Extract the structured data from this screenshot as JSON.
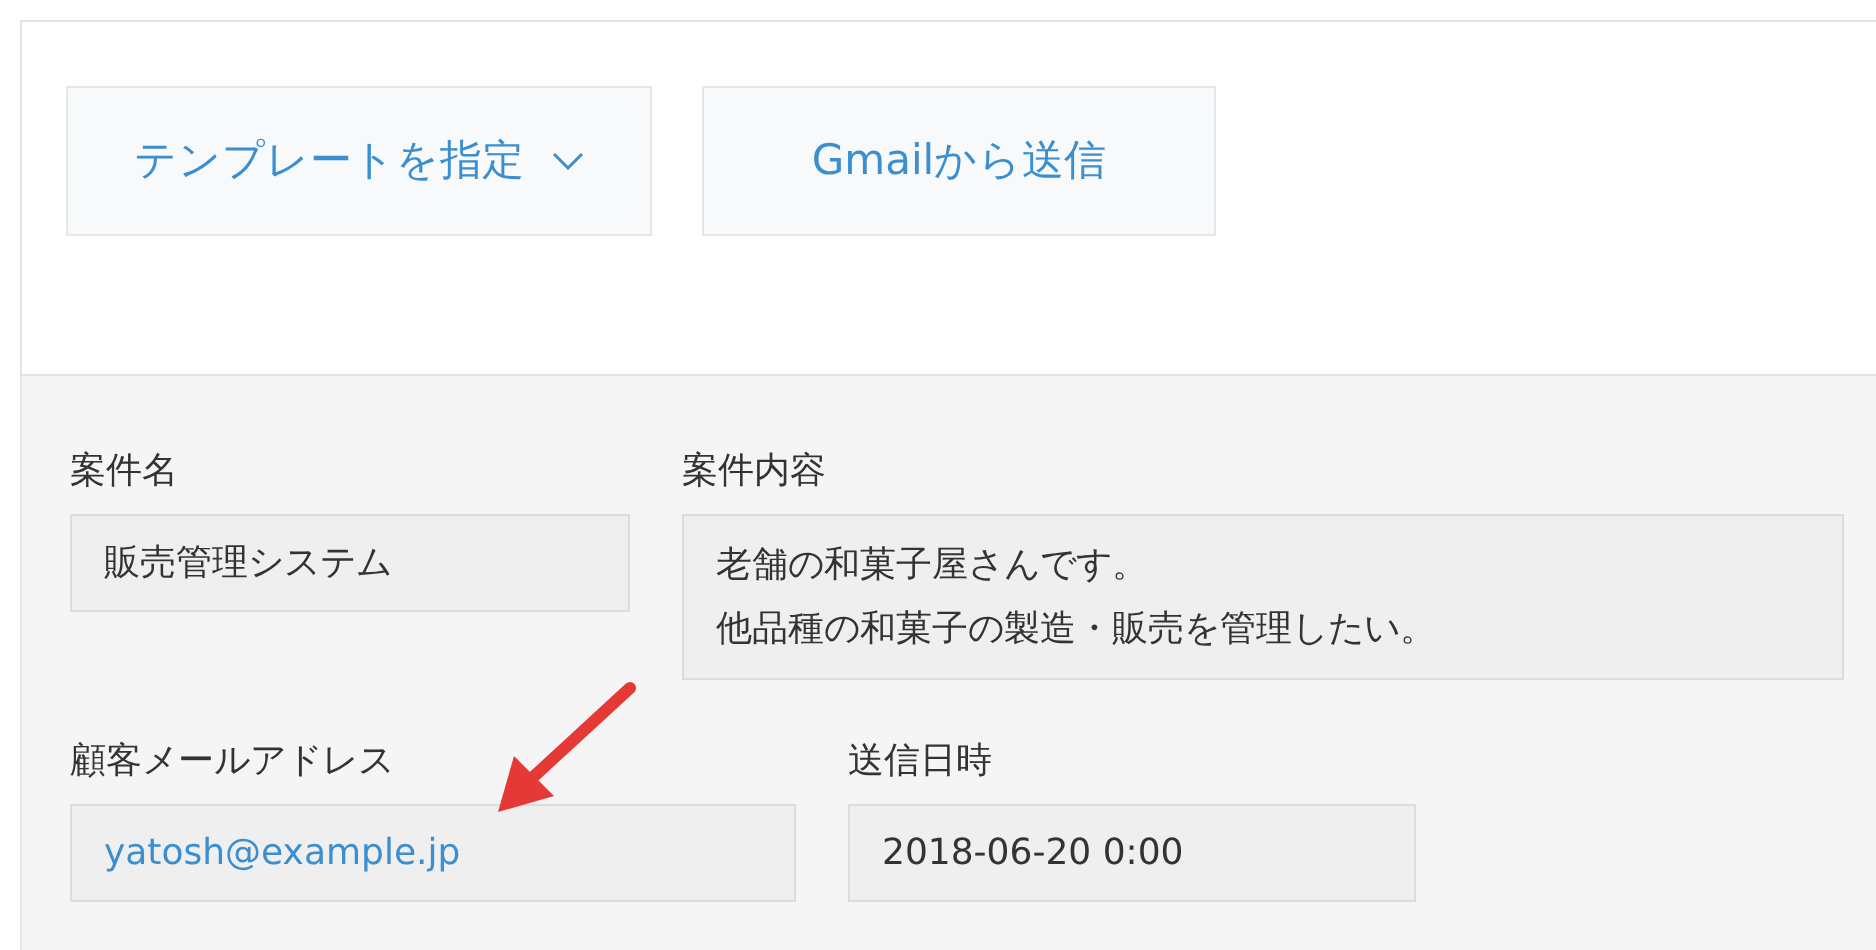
{
  "toolbar": {
    "buttons": [
      {
        "label": "テンプレートを指定",
        "kind": "dropdown"
      },
      {
        "label": "Gmailから送信",
        "kind": "plain"
      }
    ]
  },
  "form": {
    "rows": [
      [
        {
          "label": "案件名",
          "kind": "text",
          "lines": [
            "販売管理システム"
          ]
        },
        {
          "label": "案件内容",
          "kind": "multiline",
          "lines": [
            "老舗の和菓子屋さんです。",
            "他品種の和菓子の製造・販売を管理したい。"
          ]
        }
      ],
      [
        {
          "label": "顧客メールアドレス",
          "kind": "link",
          "lines": [
            "yatosh@example.jp"
          ]
        },
        {
          "label": "送信日時",
          "kind": "text",
          "lines": [
            "2018-06-20 0:00"
          ]
        }
      ]
    ]
  }
}
